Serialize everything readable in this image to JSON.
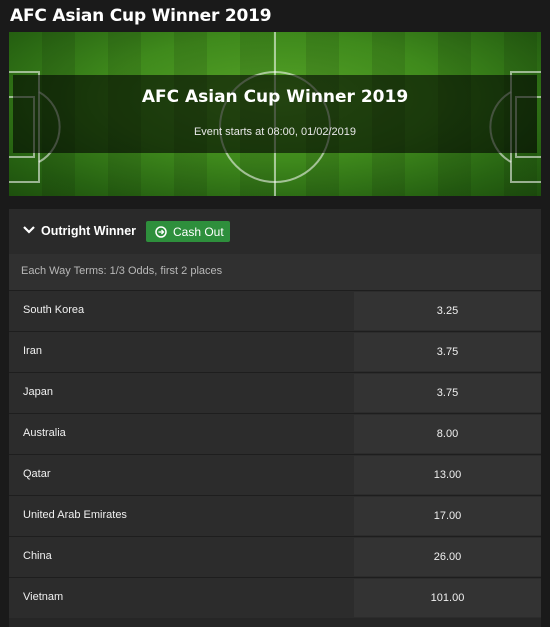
{
  "page": {
    "title": "AFC Asian Cup Winner 2019"
  },
  "banner": {
    "title": "AFC Asian Cup Winner 2019",
    "subtitle": "Event starts at 08:00, 01/02/2019"
  },
  "market": {
    "name": "Outright Winner",
    "cashout_label": "Cash Out",
    "each_way_terms": "Each Way Terms: 1/3 Odds, first 2 places",
    "runners": [
      {
        "name": "South Korea",
        "odds": "3.25"
      },
      {
        "name": "Iran",
        "odds": "3.75"
      },
      {
        "name": "Japan",
        "odds": "3.75"
      },
      {
        "name": "Australia",
        "odds": "8.00"
      },
      {
        "name": "Qatar",
        "odds": "13.00"
      },
      {
        "name": "United Arab Emirates",
        "odds": "17.00"
      },
      {
        "name": "China",
        "odds": "26.00"
      },
      {
        "name": "Vietnam",
        "odds": "101.00"
      }
    ]
  },
  "colors": {
    "background": "#1a1a1a",
    "panel": "#262626",
    "cashout_green": "#2e8f3c",
    "text": "#ffffff"
  },
  "icons": {
    "collapse": "chevron-down-icon",
    "cashout": "cashout-icon"
  }
}
